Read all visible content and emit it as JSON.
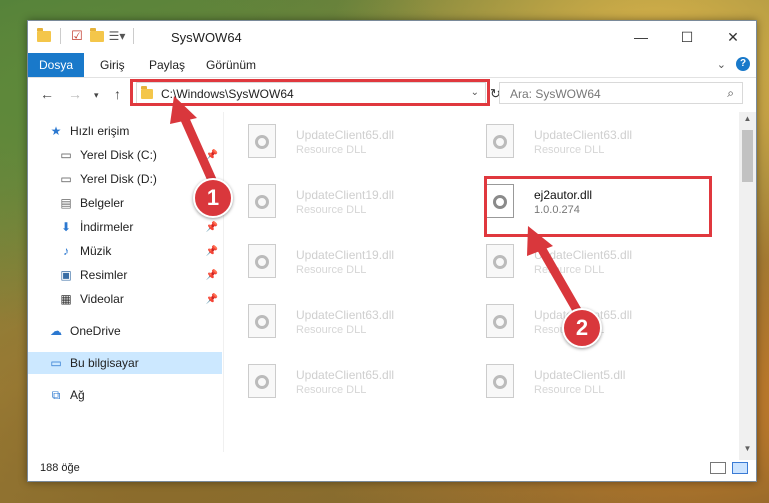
{
  "window": {
    "title": "SysWOW64"
  },
  "ribbon": {
    "tabs": [
      "Dosya",
      "Giriş",
      "Paylaş",
      "Görünüm"
    ],
    "accent": "#1979ca"
  },
  "address": {
    "path": "C:\\Windows\\SysWOW64"
  },
  "search": {
    "placeholder": "Ara: SysWOW64"
  },
  "sidebar": {
    "items": [
      {
        "label": "Hızlı erişim",
        "icon": "star-icon"
      },
      {
        "label": "Yerel Disk (C:)",
        "icon": "drive-icon"
      },
      {
        "label": "Yerel Disk (D:)",
        "icon": "drive-icon"
      },
      {
        "label": "Belgeler",
        "icon": "documents-icon"
      },
      {
        "label": "İndirmeler",
        "icon": "download-icon"
      },
      {
        "label": "Müzik",
        "icon": "music-icon"
      },
      {
        "label": "Resimler",
        "icon": "pictures-icon"
      },
      {
        "label": "Videolar",
        "icon": "videos-icon"
      },
      {
        "label": "OneDrive",
        "icon": "cloud-icon"
      },
      {
        "label": "Bu bilgisayar",
        "icon": "computer-icon"
      },
      {
        "label": "Ağ",
        "icon": "network-icon"
      }
    ]
  },
  "files": [
    {
      "name": "UpdateClient65.dll",
      "desc": "Resource DLL"
    },
    {
      "name": "UpdateClient63.dll",
      "desc": "Resource DLL"
    },
    {
      "name": "UpdateClient19.dll",
      "desc": "Resource DLL"
    },
    {
      "name": "ej2autor.dll",
      "desc": "1.0.0.274"
    },
    {
      "name": "UpdateClient19.dll",
      "desc": "Resource DLL"
    },
    {
      "name": "UpdateClient65.dll",
      "desc": "Resource DLL"
    },
    {
      "name": "UpdateClient63.dll",
      "desc": "Resource DLL"
    },
    {
      "name": "UpdateClient65.dll",
      "desc": "Resource DLL"
    },
    {
      "name": "UpdateClient65.dll",
      "desc": "Resource DLL"
    },
    {
      "name": "UpdateClient5.dll",
      "desc": "Resource DLL"
    }
  ],
  "status": {
    "count": "188 öğe"
  },
  "callouts": {
    "one": "1",
    "two": "2",
    "color": "#d9373c"
  }
}
